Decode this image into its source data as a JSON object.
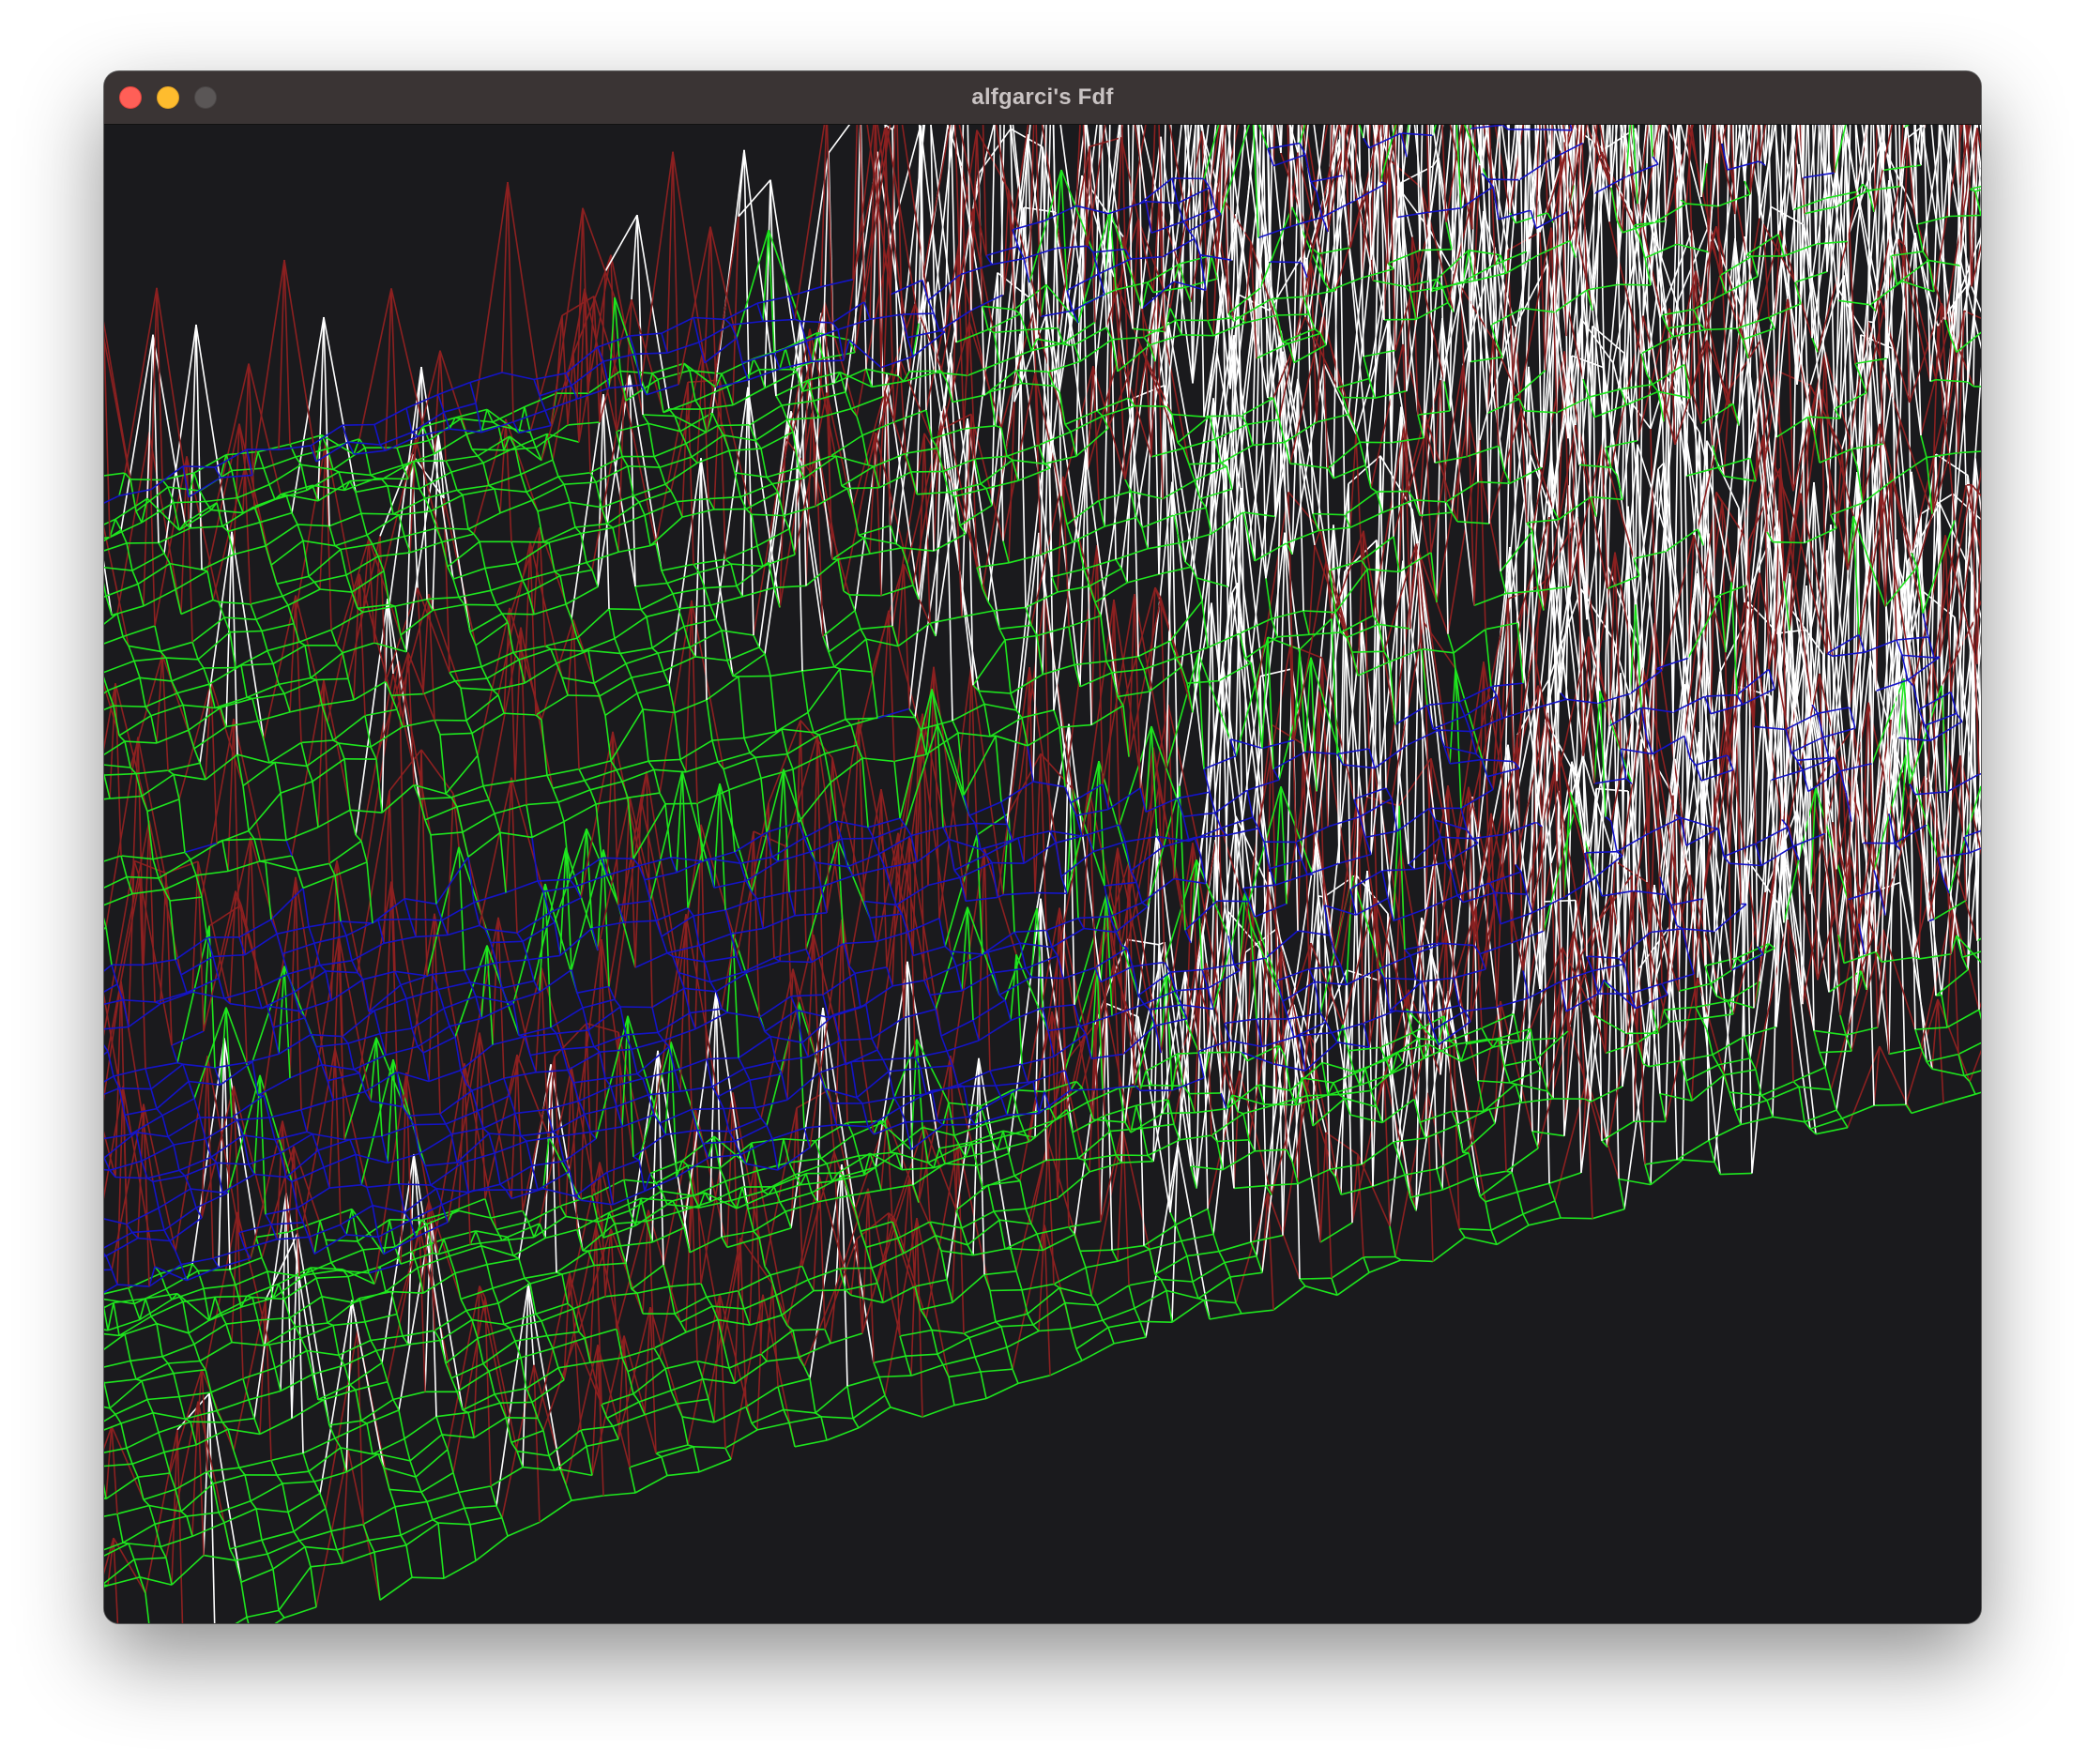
{
  "window": {
    "title": "alfgarci's Fdf",
    "controls": [
      "close",
      "minimize",
      "zoom"
    ]
  },
  "wireframe": {
    "background_color": "#1a1a1d",
    "colors": {
      "low": "#1414c8",
      "mid": "#1ee61e",
      "high": "#8c2020",
      "peak": "#ffffff"
    }
  }
}
